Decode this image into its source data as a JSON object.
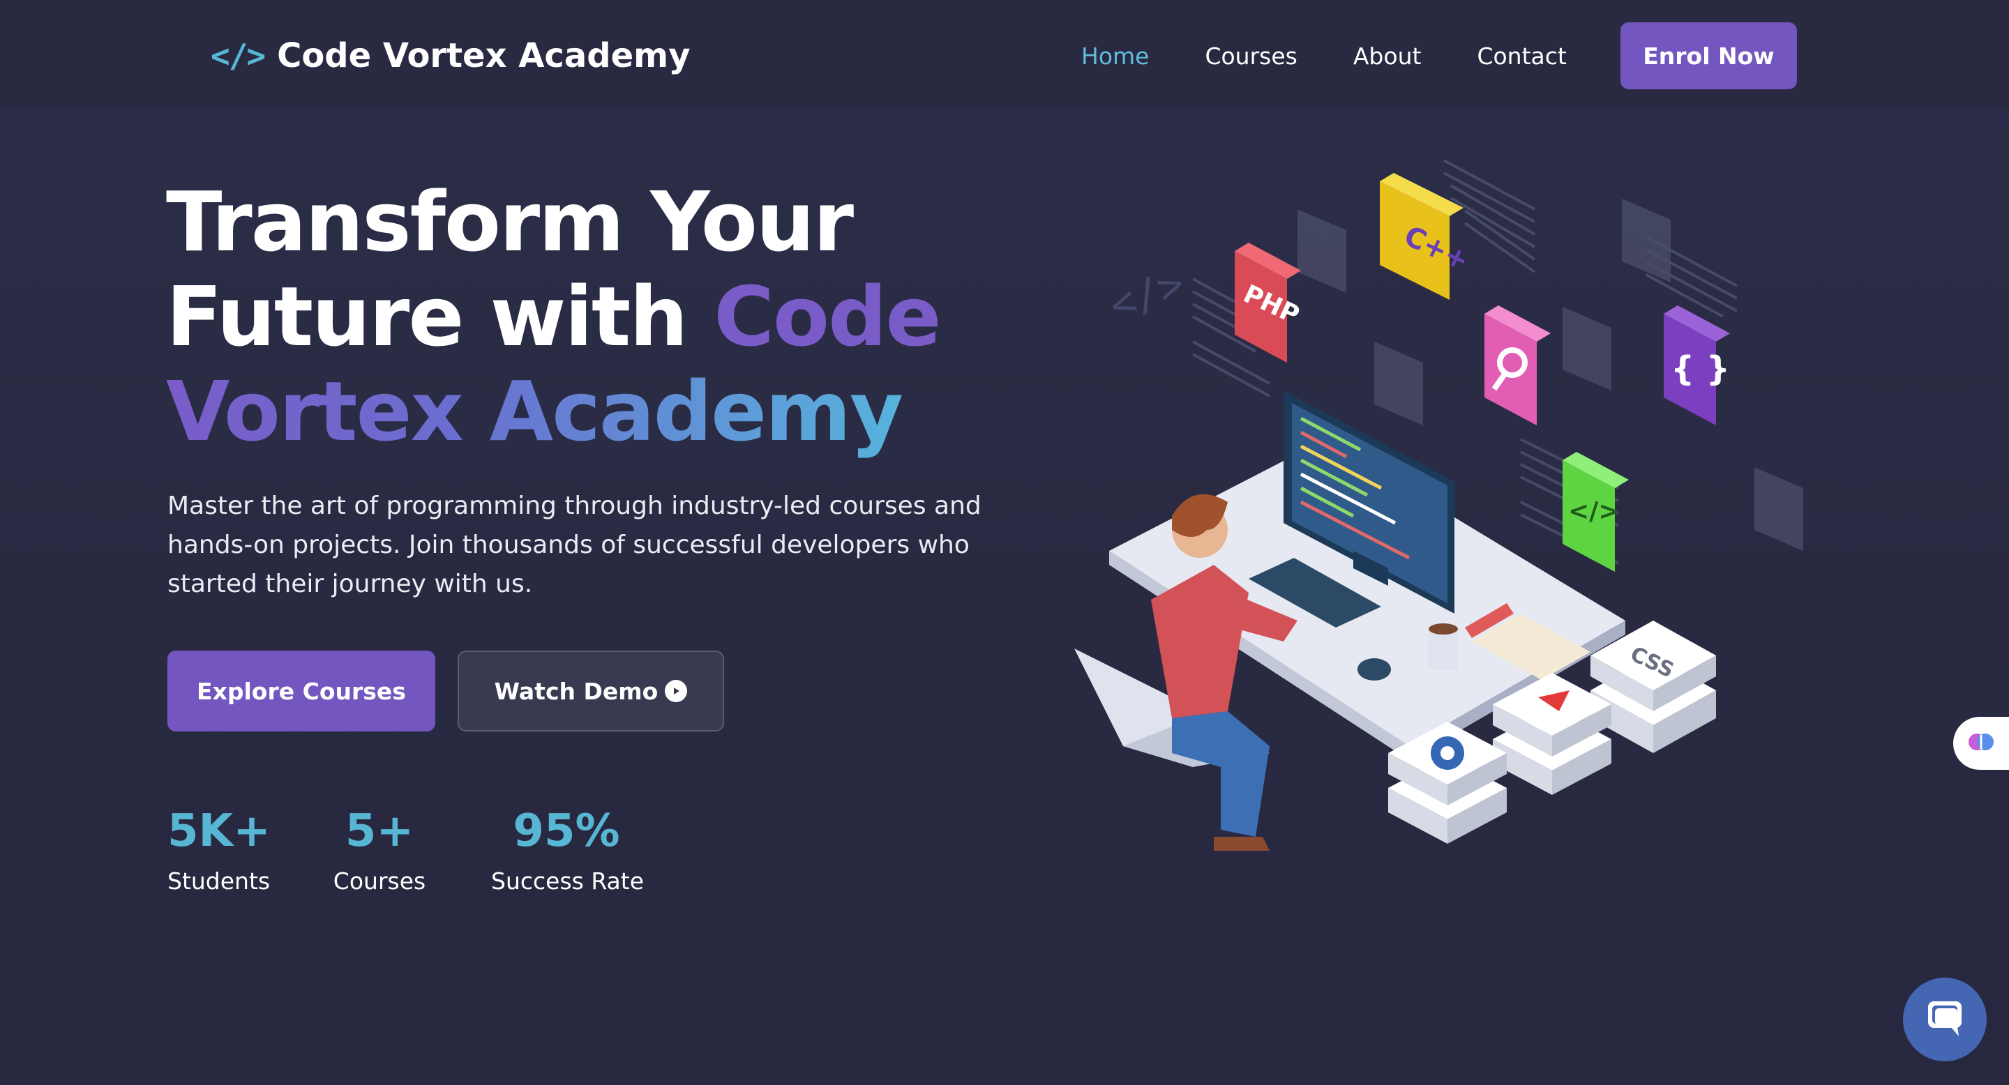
{
  "header": {
    "logo_icon": "</>",
    "logo_text": "Code Vortex Academy",
    "nav": [
      {
        "label": "Home",
        "active": true
      },
      {
        "label": "Courses",
        "active": false
      },
      {
        "label": "About",
        "active": false
      },
      {
        "label": "Contact",
        "active": false
      }
    ],
    "cta_label": "Enrol Now"
  },
  "hero": {
    "title_line1": "Transform Your",
    "title_line2_plain": "Future with ",
    "title_line2_accent": "Code",
    "title_line3_accent": "Vortex Academy",
    "description": "Master the art of programming through industry-led courses and hands-on projects. Join thousands of successful developers who started their journey with us.",
    "primary_button": "Explore Courses",
    "secondary_button": "Watch Demo"
  },
  "stats": [
    {
      "value": "5K+",
      "label": "Students"
    },
    {
      "value": "5+",
      "label": "Courses"
    },
    {
      "value": "95%",
      "label": "Success Rate"
    }
  ],
  "illustration": {
    "cards": [
      "C++",
      "PHP",
      "{ }",
      "</>",
      "CSS"
    ]
  },
  "colors": {
    "background": "#2a2b43",
    "accent_purple": "#7356bf",
    "accent_cyan": "#56b6d4"
  },
  "icons": {
    "logo": "code-brackets-icon",
    "play": "play-circle-icon",
    "brain": "brain-icon",
    "chat": "chat-bubble-icon"
  }
}
